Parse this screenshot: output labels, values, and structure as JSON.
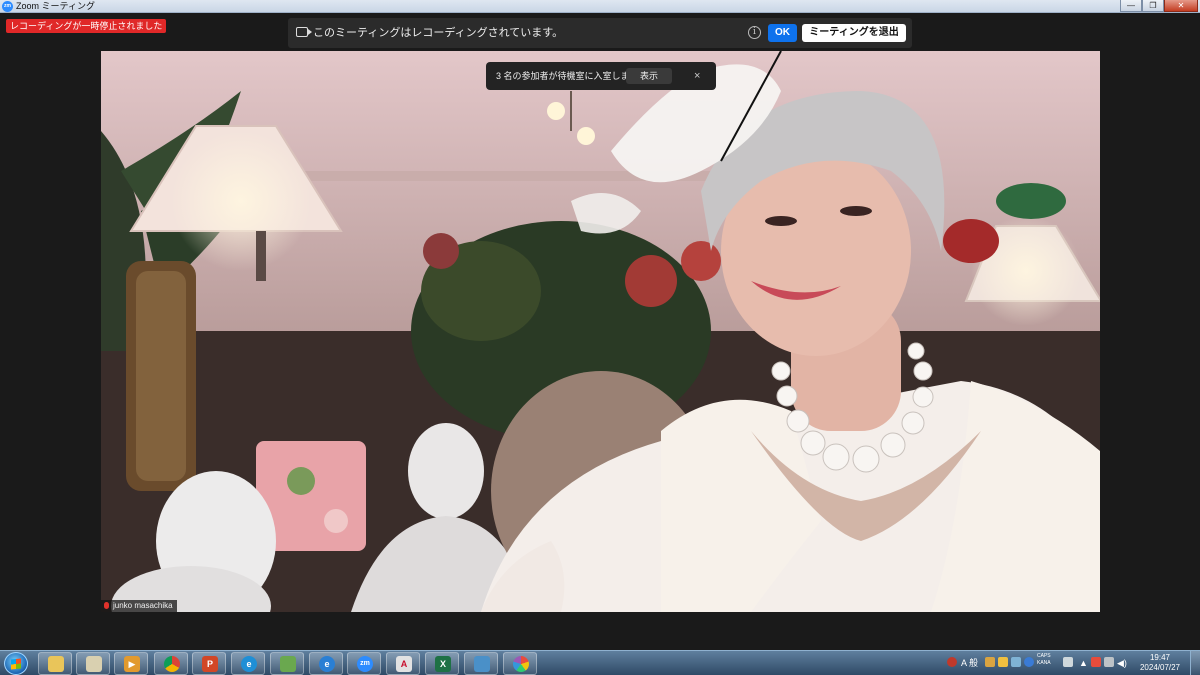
{
  "window": {
    "app_icon": "zm",
    "title": "Zoom ミーティング",
    "min_icon": "minimize-icon",
    "restore_icon": "restore-icon",
    "close_icon": "close-icon"
  },
  "recording_status": {
    "paused_text": "レコーディングが一時停止されました"
  },
  "recording_banner": {
    "text": "このミーティングはレコーディングされています。",
    "info_glyph": "i",
    "ok_label": "OK",
    "leave_label": "ミーティングを退出"
  },
  "waiting_room_toast": {
    "text": "3 名の参加者が待機室に入室しました",
    "show_label": "表示",
    "close_glyph": "×"
  },
  "participant": {
    "name": "junko masachika",
    "muted": true
  },
  "taskbar": {
    "apps": [
      {
        "name": "windows-explorer",
        "glyph": ""
      },
      {
        "name": "file-manager",
        "glyph": ""
      },
      {
        "name": "media-player",
        "glyph": "▶"
      },
      {
        "name": "chrome",
        "glyph": ""
      },
      {
        "name": "powerpoint",
        "glyph": "P"
      },
      {
        "name": "edge",
        "glyph": "e"
      },
      {
        "name": "mail",
        "glyph": ""
      },
      {
        "name": "internet-explorer",
        "glyph": "e"
      },
      {
        "name": "zoom",
        "glyph": "zm"
      },
      {
        "name": "acrobat",
        "glyph": "A"
      },
      {
        "name": "excel",
        "glyph": "X"
      },
      {
        "name": "photo-viewer",
        "glyph": ""
      },
      {
        "name": "paint",
        "glyph": ""
      }
    ],
    "ime": "A 般",
    "caps": "CAPS",
    "kana": "KANA",
    "time": "19:47",
    "date": "2024/07/27"
  },
  "colors": {
    "zoom_blue": "#0e72ed",
    "rec_red": "#e02828",
    "banner_bg": "#2b2b2b"
  }
}
